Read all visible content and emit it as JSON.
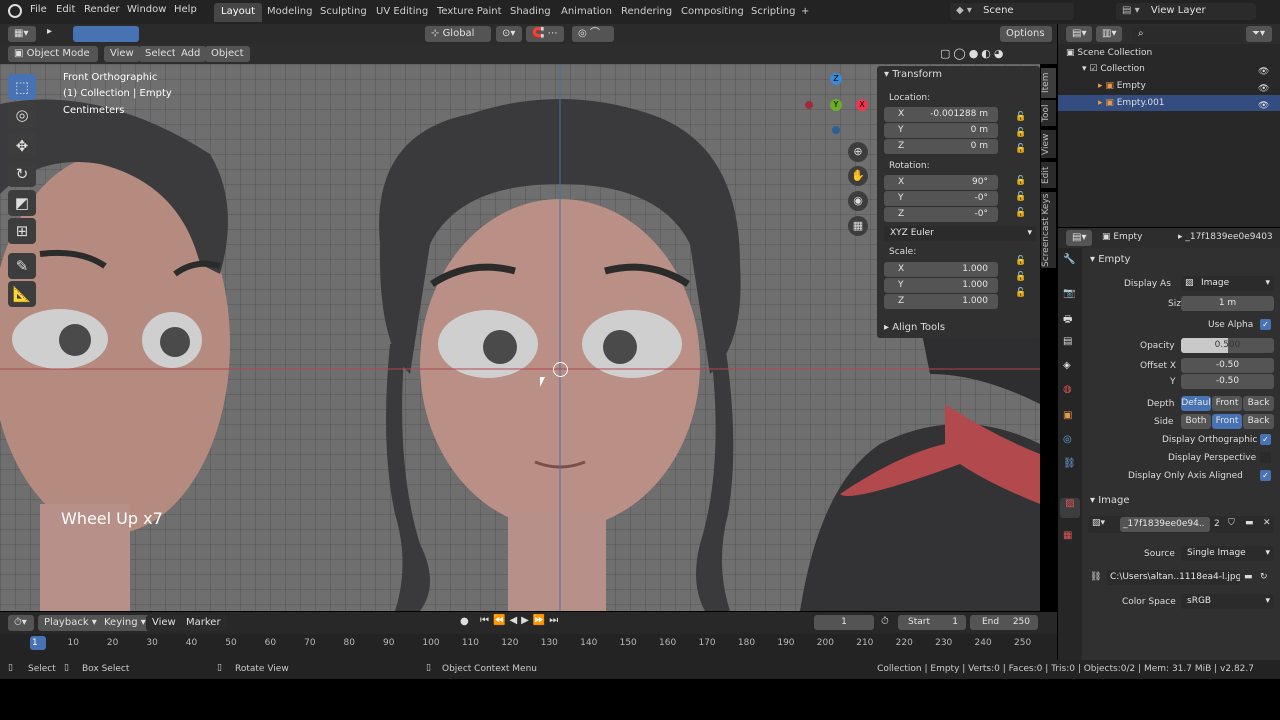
{
  "topbar": {
    "menus": [
      "File",
      "Edit",
      "Render",
      "Window",
      "Help"
    ],
    "workspaces": [
      "Layout",
      "Modeling",
      "Sculpting",
      "UV Editing",
      "Texture Paint",
      "Shading",
      "Animation",
      "Rendering",
      "Compositing",
      "Scripting"
    ],
    "add_tab": "+",
    "scene": "Scene",
    "view_layer": "View Layer"
  },
  "viewport_header": {
    "mode": "Object Mode",
    "menus": [
      "View",
      "Select",
      "Add",
      "Object"
    ],
    "orientation": "Global",
    "options": "Options"
  },
  "viewport": {
    "view_name": "Front Orthographic",
    "collection_info": "(1) Collection | Empty",
    "units": "Centimeters",
    "wheel_text": "Wheel Up x7",
    "gizmo": {
      "z": "Z",
      "y": "Y",
      "x": "X"
    }
  },
  "npanel": {
    "transform_title": "Transform",
    "location_label": "Location:",
    "location": [
      {
        "axis": "X",
        "value": "-0.001288 m"
      },
      {
        "axis": "Y",
        "value": "0 m"
      },
      {
        "axis": "Z",
        "value": "0 m"
      }
    ],
    "rotation_label": "Rotation:",
    "rotation": [
      {
        "axis": "X",
        "value": "90°"
      },
      {
        "axis": "Y",
        "value": "-0°"
      },
      {
        "axis": "Z",
        "value": "-0°"
      }
    ],
    "rotation_mode": "XYZ Euler",
    "scale_label": "Scale:",
    "scale": [
      {
        "axis": "X",
        "value": "1.000"
      },
      {
        "axis": "Y",
        "value": "1.000"
      },
      {
        "axis": "Z",
        "value": "1.000"
      }
    ],
    "align_tools": "Align Tools",
    "side_tabs": [
      "Item",
      "Tool",
      "View",
      "Edit",
      "Screencast Keys"
    ]
  },
  "outliner": {
    "root": "Scene Collection",
    "collection": "Collection",
    "items": [
      "Empty",
      "Empty.001"
    ]
  },
  "properties": {
    "header_object": "Empty",
    "header_data": "_17f1839ee0e9403",
    "section": "Empty",
    "display_as_label": "Display As",
    "display_as": "Image",
    "size_label": "Size",
    "size": "1 m",
    "use_alpha": "Use Alpha",
    "opacity_label": "Opacity",
    "opacity": "0.500",
    "opacity_fraction": 0.5,
    "offset_x_label": "Offset X",
    "offset_x": "-0.50",
    "offset_y_label": "Y",
    "offset_y": "-0.50",
    "depth_label": "Depth",
    "depth_options": [
      "Defaul",
      "Front",
      "Back"
    ],
    "side_label": "Side",
    "side_options": [
      "Both",
      "Front",
      "Back"
    ],
    "display_orthographic": "Display Orthographic",
    "display_perspective": "Display Perspective",
    "display_axis_aligned": "Display Only Axis Aligned",
    "image_section": "Image",
    "image_name": "_17f1839ee0e94..",
    "image_users": "2",
    "source_label": "Source",
    "source": "Single Image",
    "filepath": "C:\\Users\\altan..1118ea4-l.jpg",
    "color_space_label": "Color Space",
    "color_space": "sRGB"
  },
  "timeline": {
    "playback": "Playback",
    "keying": "Keying",
    "view": "View",
    "marker": "Marker",
    "current_frame": "1",
    "start_label": "Start",
    "start": "1",
    "end_label": "End",
    "end": "250",
    "ruler": [
      "1",
      "10",
      "20",
      "30",
      "40",
      "50",
      "60",
      "70",
      "80",
      "90",
      "100",
      "110",
      "120",
      "130",
      "140",
      "150",
      "160",
      "170",
      "180",
      "190",
      "200",
      "210",
      "220",
      "230",
      "240",
      "250"
    ]
  },
  "status": {
    "select": "Select",
    "box_select": "Box Select",
    "rotate_view": "Rotate View",
    "context_menu": "Object Context Menu",
    "stats": "Collection | Empty | Verts:0 | Faces:0 | Tris:0 | Objects:0/2 | Mem: 31.7 MiB | v2.82.7"
  },
  "colors": {
    "accent": "#4772b3",
    "x_axis": "#f0354f",
    "y_axis": "#6aad29",
    "z_axis": "#3b8ad8"
  }
}
